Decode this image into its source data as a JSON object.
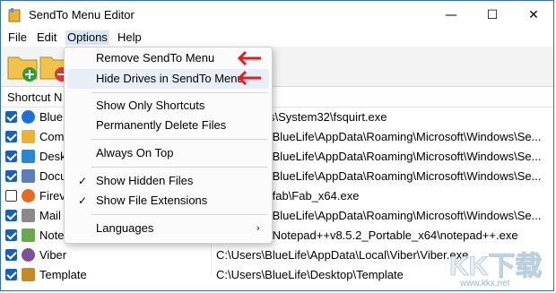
{
  "window": {
    "title": "SendTo Menu Editor",
    "min_glyph": "—",
    "max_glyph": "☐",
    "close_glyph": "✕"
  },
  "menubar": {
    "file": "File",
    "edit": "Edit",
    "options": "Options",
    "help": "Help"
  },
  "toolbar": {
    "add_icon": "folder-add-icon",
    "remove_icon": "folder-remove-icon"
  },
  "list": {
    "column_name": "Shortcut N",
    "rows": [
      {
        "checked": true,
        "name": "Blue",
        "path": "s\\System32\\fsquirt.exe",
        "icon": "bluetooth-icon",
        "color": "#1e6fd9"
      },
      {
        "checked": true,
        "name": "Com",
        "path": "\\BlueLife\\AppData\\Roaming\\Microsoft\\Windows\\Se...",
        "icon": "compressed-folder-icon",
        "color": "#e8b33a"
      },
      {
        "checked": true,
        "name": "Desk",
        "path": "\\BlueLife\\AppData\\Roaming\\Microsoft\\Windows\\Se...",
        "icon": "desktop-icon",
        "color": "#2c86d6"
      },
      {
        "checked": true,
        "name": "Docu",
        "path": "\\BlueLife\\AppData\\Roaming\\Microsoft\\Windows\\Se...",
        "icon": "documents-icon",
        "color": "#5a7fb8"
      },
      {
        "checked": false,
        "name": "Firev",
        "path": "\\fab\\Fab_x64.exe",
        "icon": "firefox-icon",
        "color": "#e66b21"
      },
      {
        "checked": true,
        "name": "Mail",
        "path": "\\BlueLife\\AppData\\Roaming\\Microsoft\\Windows\\Se...",
        "icon": "mail-icon",
        "color": "#8a8a8a"
      },
      {
        "checked": true,
        "name": "Notep",
        "path": "\\Notepad++v8.5.2_Portable_x64\\notepad++.exe",
        "icon": "notepad-icon",
        "color": "#6aa84f"
      },
      {
        "checked": true,
        "name": "Viber",
        "path": "C:\\Users\\BlueLife\\AppData\\Local\\Viber\\Viber.exe",
        "icon": "viber-icon",
        "color": "#7b519d"
      },
      {
        "checked": true,
        "name": "Template",
        "path": "C:\\Users\\BlueLife\\Desktop\\Template",
        "icon": "template-icon",
        "color": "#c48a2a"
      }
    ]
  },
  "options_menu": {
    "remove_sendto": "Remove SendTo Menu",
    "hide_drives": "Hide Drives in SendTo Menu",
    "show_only_shortcuts": "Show Only Shortcuts",
    "permanently_delete": "Permanently Delete Files",
    "always_on_top": "Always On Top",
    "show_hidden": "Show Hidden Files",
    "show_extensions": "Show File Extensions",
    "languages": "Languages",
    "check_glyph": "✓",
    "submenu_glyph": "›"
  },
  "colors": {
    "accent": "#1a5fb4",
    "arrow": "#e02020"
  },
  "watermark": {
    "logo_text": "KK下载",
    "url": "www.kkx.net"
  }
}
